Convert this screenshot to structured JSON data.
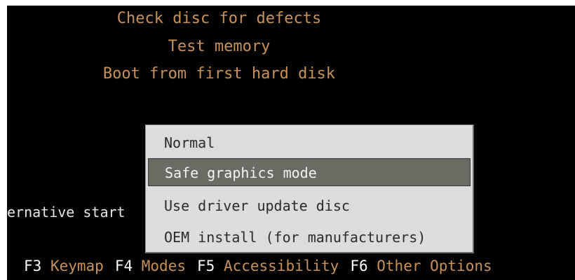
{
  "boot_menu": {
    "items": [
      {
        "label": "Check disc for defects"
      },
      {
        "label": "Test memory"
      },
      {
        "label": "Boot from first hard disk"
      }
    ],
    "partial_label": "ernative start",
    "label_color": "#c8915a"
  },
  "popup_menu": {
    "items": [
      {
        "label": "Normal",
        "selected": false
      },
      {
        "label": "Safe graphics mode",
        "selected": true
      },
      {
        "label": "Use driver update disc",
        "selected": false
      },
      {
        "label": "OEM install (for manufacturers)",
        "selected": false
      }
    ],
    "background": "#dcdcdc",
    "selected_background": "#6b6b63"
  },
  "function_keys": [
    {
      "key": "F3",
      "label": "Keymap"
    },
    {
      "key": "F4",
      "label": "Modes"
    },
    {
      "key": "F5",
      "label": "Accessibility"
    },
    {
      "key": "F6",
      "label": "Other Options"
    }
  ]
}
